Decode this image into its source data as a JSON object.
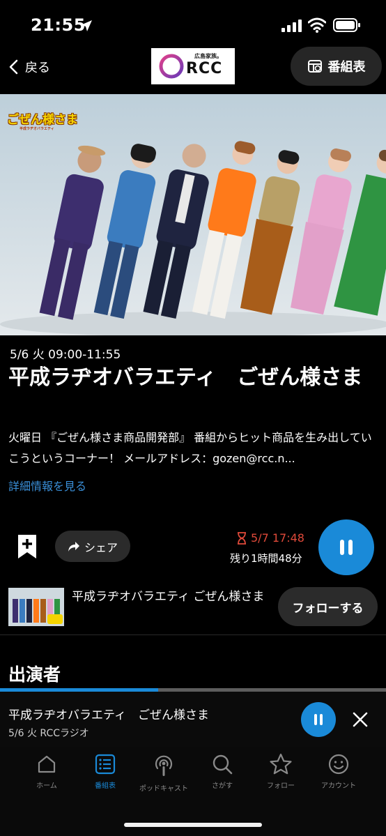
{
  "status_bar": {
    "time": "21:55"
  },
  "header": {
    "back_label": "戻る",
    "logo_small": "広島家族。",
    "logo_text": "RCC",
    "schedule_label": "番組表"
  },
  "hero": {
    "title_logo": "ごぜん様さま",
    "title_logo_sub": "平成ラヂオバラエティ"
  },
  "program": {
    "air_time": "5/6 火 09:00-11:55",
    "title": "平成ラヂオバラエティ　ごぜん様さま",
    "description": "火曜日 『ごぜん様さま商品開発部』 番組からヒット商品を生み出していこうというコーナー！ メールアドレス：gozen@rcc.n...",
    "details_link": "詳細情報を見る"
  },
  "actions": {
    "share_label": "シェア",
    "deadline": "5/7 17:48",
    "remaining": "残り1時間48分"
  },
  "follow": {
    "program_name": "平成ラヂオバラエティ ごぜん様さま",
    "button_label": "フォローする"
  },
  "cast": {
    "heading": "出演者"
  },
  "mini_player": {
    "title": "平成ラヂオバラエティ　ごぜん様さま",
    "subtitle": "5/6 火 RCCラジオ",
    "progress": 0.41
  },
  "tabs": [
    {
      "label": "ホーム",
      "icon": "home-icon"
    },
    {
      "label": "番組表",
      "icon": "list-icon",
      "active": true
    },
    {
      "label": "ポッドキャスト",
      "icon": "podcast-icon"
    },
    {
      "label": "さがす",
      "icon": "search-icon"
    },
    {
      "label": "フォロー",
      "icon": "star-icon"
    },
    {
      "label": "アカウント",
      "icon": "account-icon"
    }
  ],
  "colors": {
    "accent": "#1a8ad8",
    "deadline": "#e04a3a",
    "link": "#3a8fd8",
    "background": "#000000"
  }
}
